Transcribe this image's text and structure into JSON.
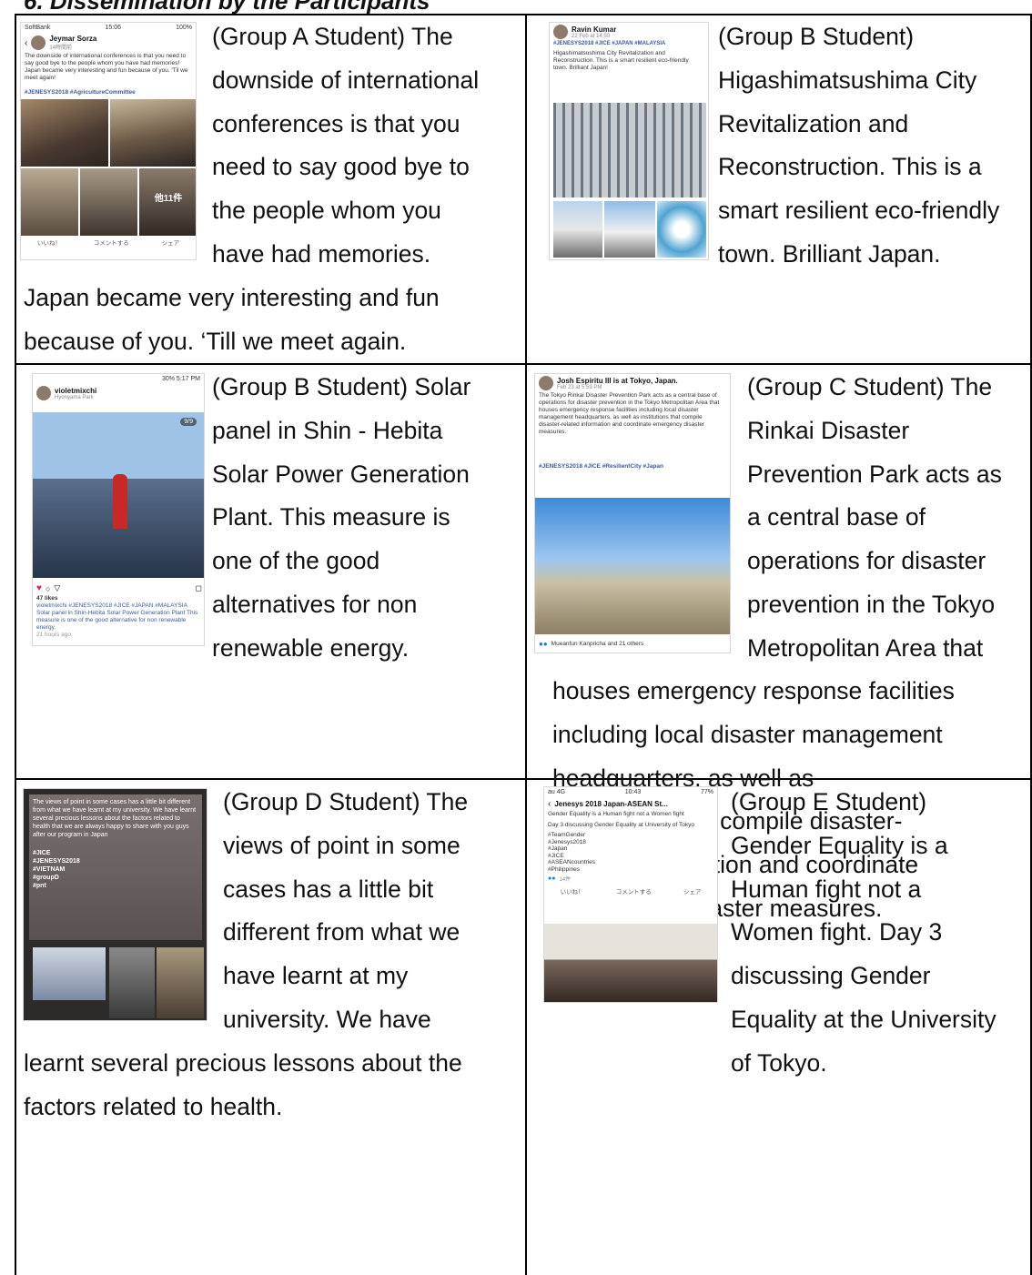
{
  "heading": "6.   Dissemination by the Participants",
  "cells": {
    "a": {
      "lines_right": [
        "(Group A Student) The",
        "downside of international",
        "conferences is that you",
        "need to say good bye to",
        "the people whom you",
        "have had memories."
      ],
      "lines_full": [
        "Japan became very interesting and fun",
        "because of you. ‘Till we meet again."
      ],
      "shot": {
        "carrier": "SoftBank",
        "time": "15:06",
        "battery": "100%",
        "user": "Jeymar Sorza",
        "date": "14時間前",
        "caption": "The downside of international conferences is that you need to say good bye to the people whom you have had memories! Japan became very interesting and fun because of you. 'Til we meet again!",
        "tags": "#JENESYS2018 #AgricultureCommittee",
        "more_count": "他11件",
        "like": "いいね！",
        "comment": "コメントする",
        "share": "シェア"
      }
    },
    "b": {
      "lines": [
        "(Group B Student)",
        "Higashimatsushima City",
        "Revitalization and",
        "Reconstruction. This is a",
        "smart resilient eco-friendly",
        "town. Brilliant Japan."
      ],
      "shot": {
        "user": "Ravin Kumar",
        "date": "22 Feb at 14:50",
        "tags": "#JENESYS2018 #JICE #JAPAN #MALAYSIA",
        "caption": "Higashimatsushima City Revitalization and Reconstruction. This is a smart resilient eco-friendly town. Brilliant Japan!"
      }
    },
    "c": {
      "lines_right": [
        "(Group B Student) Solar",
        "panel in Shin - Hebita",
        "Solar Power Generation",
        "Plant.   This measure is",
        "one    of    the    good",
        "alternatives    for    non",
        "renewable energy."
      ],
      "shot": {
        "status": "30%  5:17 PM",
        "user": "violetmixchi",
        "location": "Hyonyama Park",
        "counter": "9/9",
        "likes": "47 likes",
        "caption": "violetmixchi #JENESYS2018 #JICE #JAPAN #MALAYSIA Solar panel in Shin-Hebita Solar Power Generation Plant This measure is one of the good alternative for non renewable energy.",
        "ago": "21 hours ago"
      }
    },
    "d": {
      "lines_right": [
        "(Group C Student) The",
        "Rinkai        Disaster",
        "Prevention Park acts as",
        "a    central    base    of",
        "operations for disaster",
        "prevention in the Tokyo",
        "Metropolitan Area that"
      ],
      "lines_full": [
        "houses emergency response facilities",
        "including local disaster management",
        "headquarters,       as       well       as",
        "institutions that compile disaster-",
        "related   information and coordinate",
        "emergency disaster measures."
      ],
      "shot": {
        "user": "Josh Espiritu III is at Tokyo, Japan.",
        "date": "Feb 23 at 5:59 PM",
        "caption": "The Tokyo Rinkai Disaster Prevention Park acts as a central base of operations for disaster prevention in the Tokyo Metropolitan Area that houses emergency response facilities including local disaster management headquarters, as well as institutions that compile disaster-related information and coordinate emergency disaster measures.",
        "tags": "#JENESYS2018 #JICE #ResilientCity #Japan",
        "reactions": "Mueanfun Kanpricha and 21 others"
      }
    },
    "e": {
      "lines_right": [
        "(Group D Student) The",
        "views of point in some",
        "cases has a little bit",
        "different from what we",
        "have   learnt   at   my",
        "university.   We   have"
      ],
      "lines_full": [
        "learnt several precious lessons about the",
        "factors related to health."
      ],
      "shot": {
        "caption": "The views of point in some cases has a little bit different from what we have learnt at my university. We have learnt several precious lessons about the factors related to health that we are always happy to share with you guys after our program in Japan",
        "tags": [
          "#JICE",
          "#JENESYS2018",
          "#VIETNAM",
          "#groupD",
          "#pnt"
        ]
      }
    },
    "f": {
      "lines": [
        "(Group E Student)",
        "Gender    Equality    is    a",
        "Human    fight    not    a",
        "Women    fight.   Day   3",
        "discussing        Gender",
        "Equality at the University",
        "of Tokyo."
      ],
      "shot": {
        "carrier": "au 4G",
        "time": "10:43",
        "battery": "77%",
        "title": "Jenesys 2018 Japan-ASEAN St...",
        "line1": "Gender Equality is a Human fight not a Women fight",
        "line2": "Day 3 discussing Gender Equality at University of Tokyo",
        "tags": [
          "#TeamGender",
          "#Jenesys2018",
          "#Japan",
          "#JICE",
          "#ASEANcountries",
          "#Philippines"
        ],
        "count": "14件",
        "like": "いいね！",
        "comment": "コメントする",
        "share": "シェア"
      }
    }
  }
}
